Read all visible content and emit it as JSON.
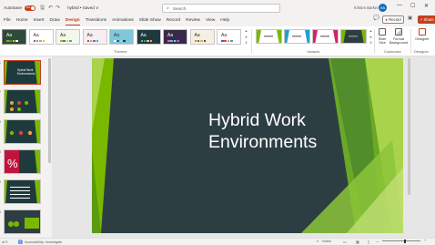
{
  "titlebar": {
    "autosave_label": "AutoSave",
    "autosave_state": "On",
    "filename": "hybrid • Saved ∨",
    "search_placeholder": "Search",
    "user_name": "Kirsten Barker",
    "user_initials": "KB",
    "minimize": "—",
    "maximize": "☐",
    "close": "✕"
  },
  "tabs": [
    "File",
    "Home",
    "Insert",
    "Draw",
    "Design",
    "Transitions",
    "Animations",
    "Slide Show",
    "Record",
    "Review",
    "View",
    "Help"
  ],
  "active_tab": "Design",
  "actions": {
    "record_label": "Record",
    "share_label": "Share"
  },
  "ribbon": {
    "themes_label": "Themes",
    "variants_label": "Variants",
    "customize_label": "Customize",
    "designer_label": "Designer",
    "slide_size_label": "Slide Size",
    "format_background_label": "Format Background",
    "designer_button_label": "Designer",
    "theme_sample": "Aa",
    "themes": [
      {
        "bg": "#2f4a3a",
        "fg": "#ffffff",
        "bars": [
          "#7ab800",
          "#3a9a3a",
          "#c8d400",
          "#ffffff"
        ]
      },
      {
        "bg": "#ffffff",
        "fg": "#323130",
        "bars": [
          "#4472c4",
          "#ed7d31",
          "#a5a5a5",
          "#ffc000"
        ]
      },
      {
        "bg": "#f4f8ec",
        "fg": "#323130",
        "bars": [
          "#8fb84a",
          "#4f8a3c",
          "#c0d86a",
          "#6aa84f"
        ]
      },
      {
        "bg": "#f7eef2",
        "fg": "#323130",
        "bars": [
          "#c0504d",
          "#9bbb59",
          "#8064a2",
          "#4bacc6"
        ]
      },
      {
        "bg": "#7fc7d9",
        "fg": "#1f3a3d",
        "bars": [
          "#ffffff",
          "#1f6f8b",
          "#99d6e5",
          "#0b4a5c"
        ]
      },
      {
        "bg": "#1f3a3d",
        "fg": "#ffffff",
        "bars": [
          "#4fb8a0",
          "#2a9d8f",
          "#e9c46a",
          "#f4a261"
        ]
      },
      {
        "bg": "#3a2a4a",
        "fg": "#ffffff",
        "bars": [
          "#d16ba5",
          "#86a8e7",
          "#5ffbf1",
          "#9b5de5"
        ]
      },
      {
        "bg": "#f5efe4",
        "fg": "#323130",
        "bars": [
          "#c48a3a",
          "#8f5a2a",
          "#d6b37a",
          "#6b4a2a"
        ]
      },
      {
        "bg": "#ffffff",
        "fg": "#323130",
        "bars": [
          "#6b4fa0",
          "#d04a7a",
          "#f0a030",
          "#3fa0d0"
        ]
      }
    ],
    "variants": [
      {
        "bg": "#ffffff",
        "accent": "#7ab800"
      },
      {
        "bg": "#ffffff",
        "accent": "#1fa0d0"
      },
      {
        "bg": "#ffffff",
        "accent": "#d0246a"
      },
      {
        "bg": "#2d3e43",
        "accent": "#7ab800"
      }
    ]
  },
  "slide": {
    "title_line1": "Hybrid Work",
    "title_line2": "Environments"
  },
  "thumbnails": [
    {
      "num": "1",
      "title": "Hybrid Work Environments"
    },
    {
      "num": "2",
      "title": ""
    },
    {
      "num": "3",
      "title": ""
    },
    {
      "num": "4",
      "title": ""
    },
    {
      "num": "5",
      "title": ""
    },
    {
      "num": "6",
      "title": ""
    }
  ],
  "statusbar": {
    "slide_count": "of 9",
    "accessibility": "Accessibility: Investigate",
    "notes_label": "Notes",
    "zoom": "—"
  },
  "colors": {
    "accent": "#c43e1c",
    "slide_bg": "#2d3e43",
    "slide_green": "#7ab800"
  }
}
